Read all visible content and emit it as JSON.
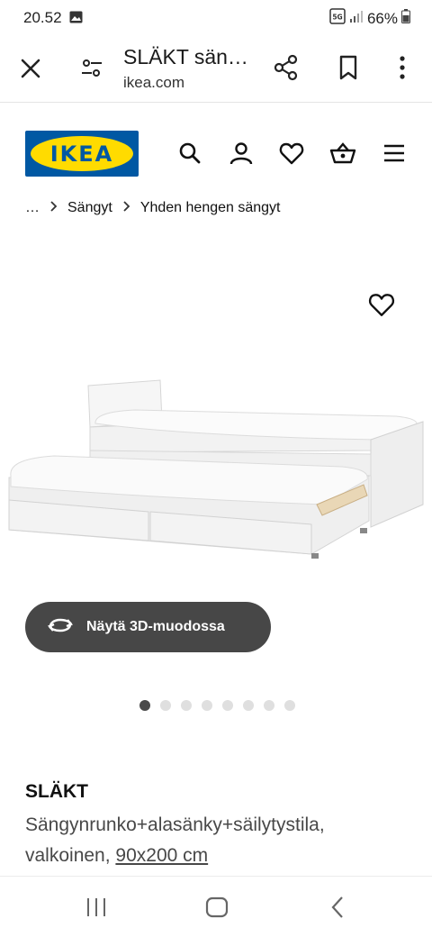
{
  "status_bar": {
    "time": "20.52",
    "network": "5G",
    "battery": "66%",
    "icons": [
      "image-icon",
      "network-5g-icon",
      "signal-icon",
      "battery-icon"
    ]
  },
  "browser": {
    "title": "SLÄKT sän…",
    "domain": "ikea.com",
    "icons": [
      "close-icon",
      "page-settings-icon",
      "share-icon",
      "bookmark-icon",
      "more-icon"
    ]
  },
  "header": {
    "logo_text": "IKEA",
    "icons": [
      "search-icon",
      "user-icon",
      "heart-icon",
      "basket-icon",
      "menu-icon"
    ]
  },
  "breadcrumb": {
    "items": [
      "…",
      "Sängyt",
      "Yhden hengen sängyt"
    ]
  },
  "gallery": {
    "view_3d_label": "Näytä 3D-muodossa",
    "dot_count": 8,
    "active_index": 0
  },
  "product": {
    "name": "SLÄKT",
    "description": "Sängynrunko+alasänky+säilytystila, valkoinen, ",
    "size": "90x200 cm"
  },
  "nav": {
    "icons": [
      "recent-apps-icon",
      "home-icon",
      "back-icon"
    ]
  },
  "colors": {
    "ikea_blue": "#0058a3",
    "ikea_yellow": "#ffdb00",
    "button_dark": "#474747"
  }
}
